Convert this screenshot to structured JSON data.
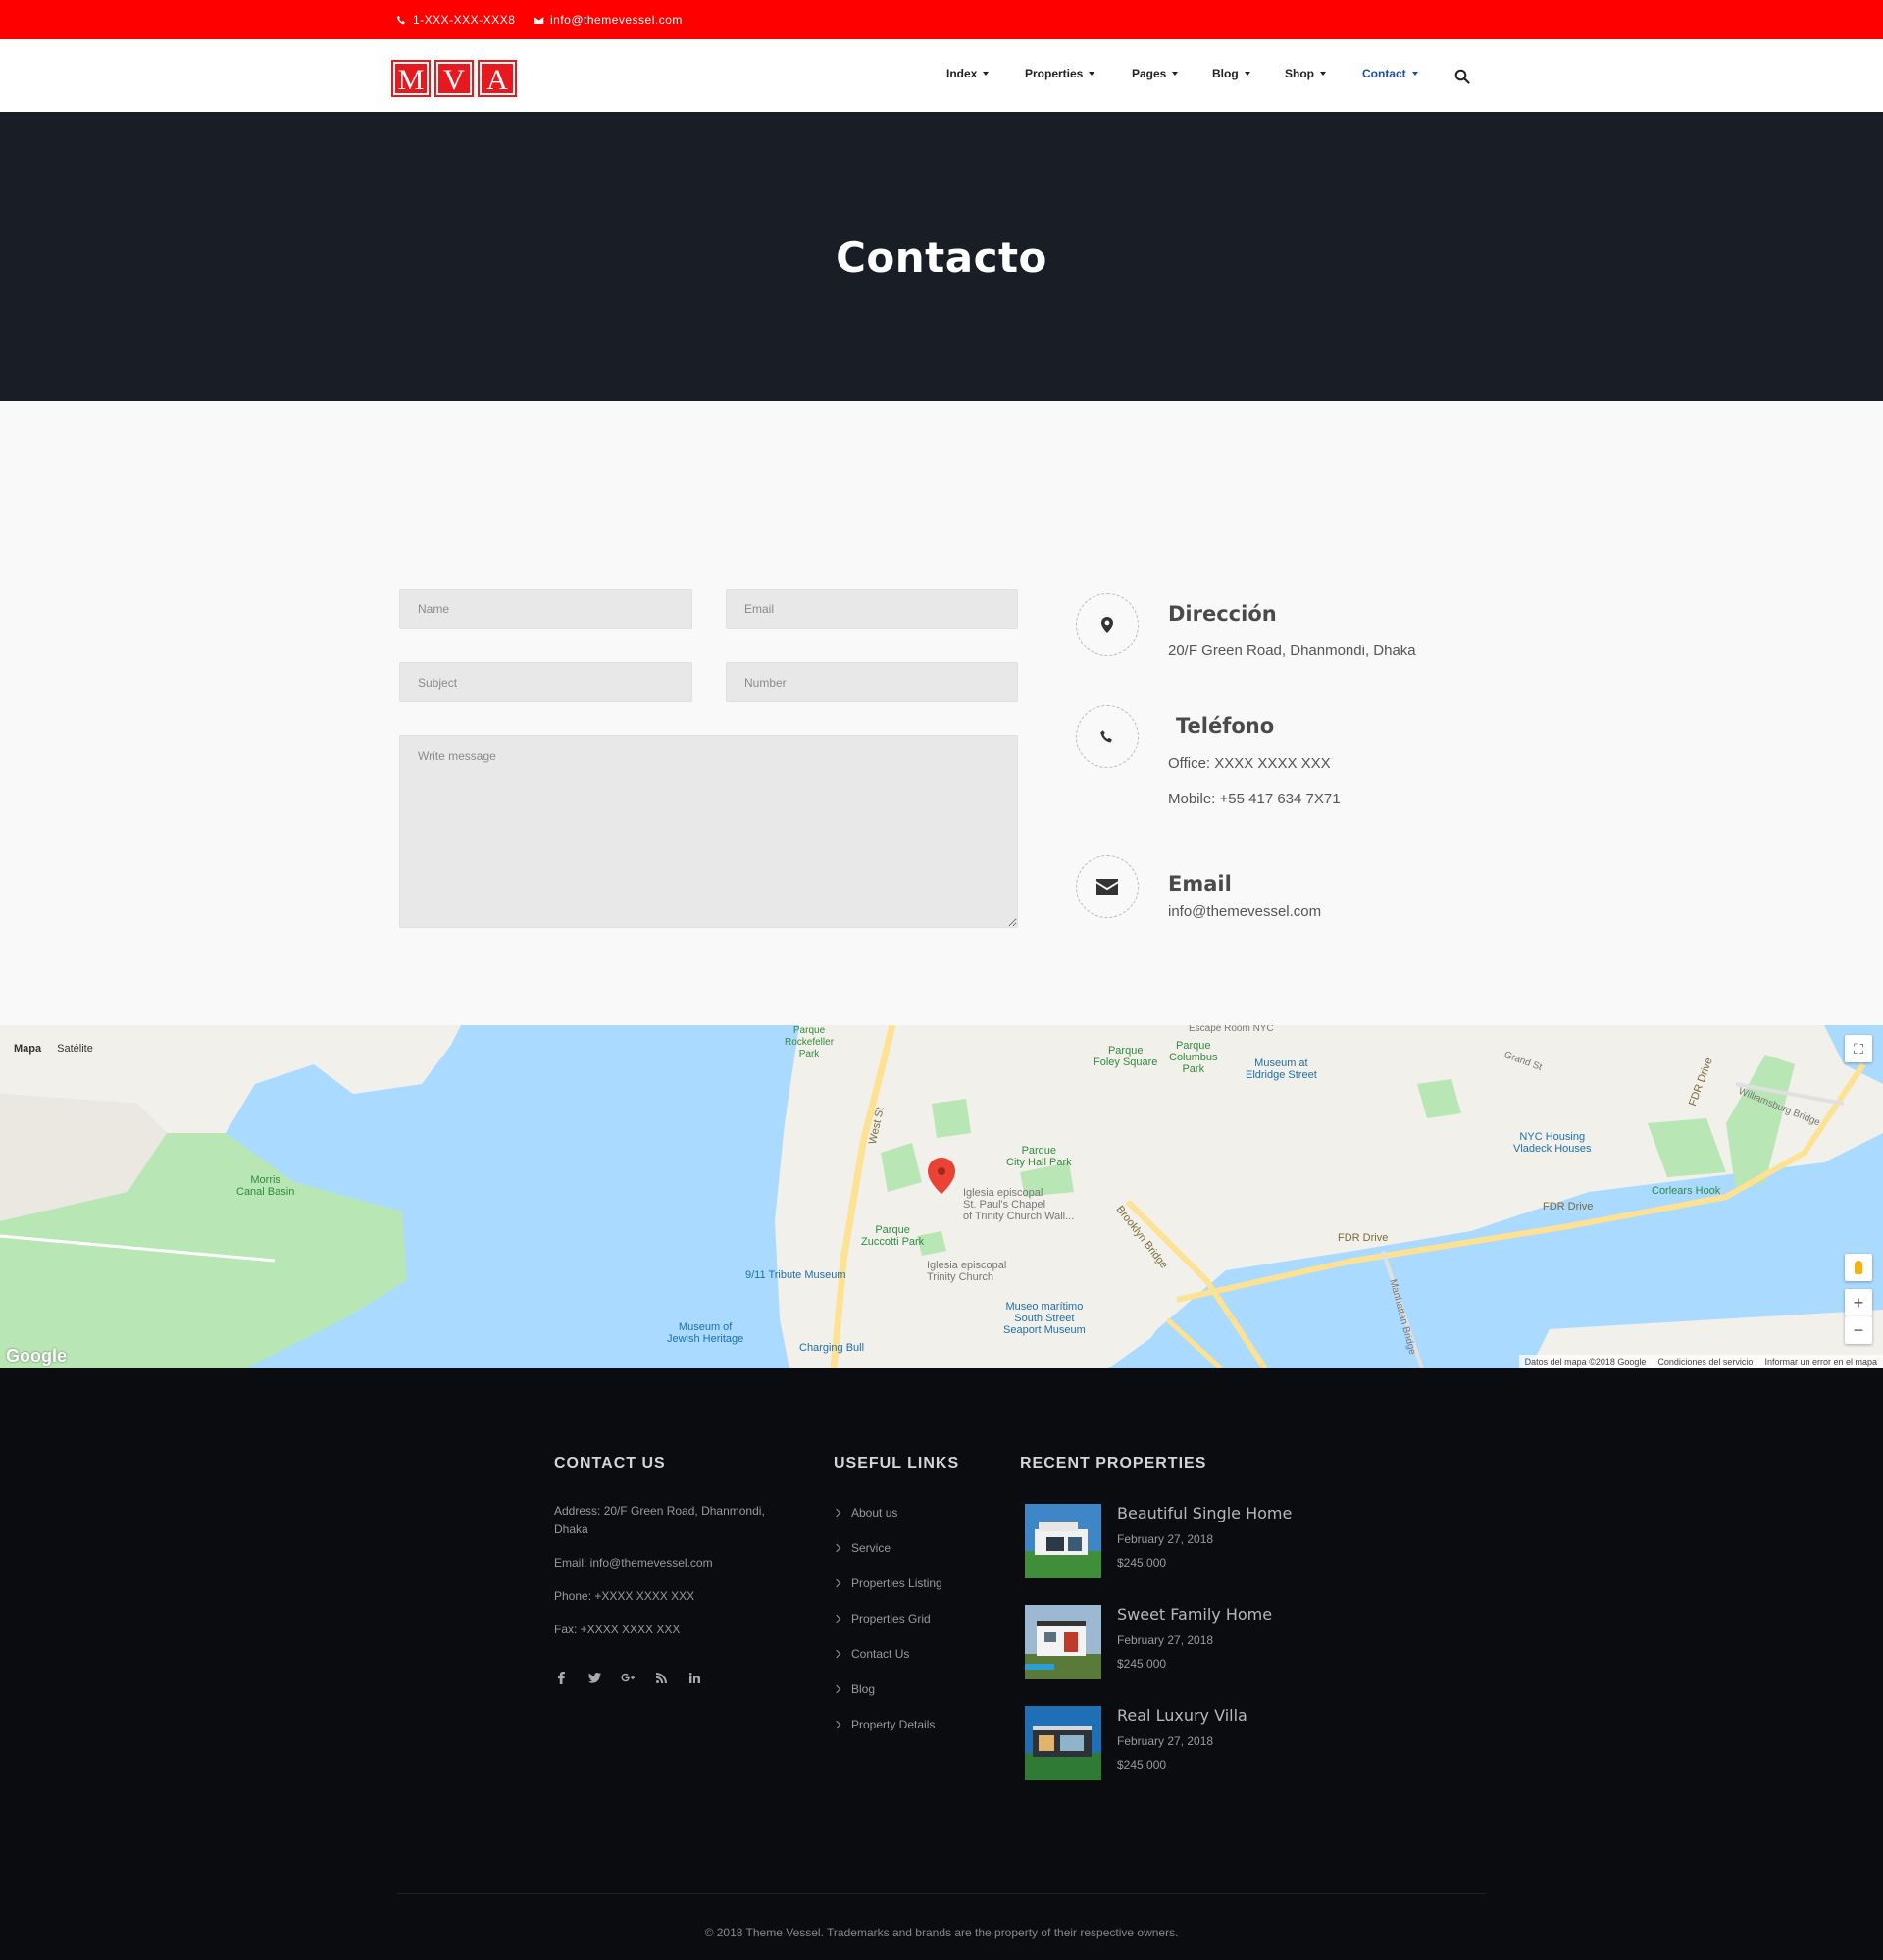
{
  "topbar": {
    "phone": "1-XXX-XXX-XXX8",
    "email": "info@themevessel.com",
    "background": "#ff0000"
  },
  "logo": {
    "letters": [
      "M",
      "V",
      "A"
    ]
  },
  "nav": {
    "items": [
      {
        "label": "Index"
      },
      {
        "label": "Properties"
      },
      {
        "label": "Pages"
      },
      {
        "label": "Blog"
      },
      {
        "label": "Shop"
      },
      {
        "label": "Contact"
      }
    ],
    "active": "Contact"
  },
  "hero": {
    "title": "Contacto"
  },
  "form": {
    "name_placeholder": "Name",
    "email_placeholder": "Email",
    "subject_placeholder": "Subject",
    "number_placeholder": "Number",
    "message_placeholder": "Write message"
  },
  "info": {
    "address": {
      "title": "Dirección",
      "line1": "20/F Green Road, Dhanmondi, Dhaka"
    },
    "phone": {
      "title": "Teléfono",
      "office": "Office: XXXX XXXX XXX",
      "mobile": "Mobile: +55 417 634 7X71"
    },
    "email": {
      "title": "Email",
      "value": "info@themevessel.com"
    }
  },
  "map": {
    "tabs": [
      "Mapa",
      "Satélite"
    ],
    "labels": {
      "morris": "Morris\nCanal Basin",
      "rockefeller": "Parque\nRockefeller\nPark",
      "foley": "Parque\nFoley Square",
      "columbus": "Parque\nColumbus\nPark",
      "eldridge": "Museum at\nEldridge Street",
      "cityhall": "Parque\nCity Hall Park",
      "stpauls": "Iglesia episcopal\nSt. Paul's Chapel\nof Trinity Church Wall...",
      "zuccotti": "Parque\nZuccotti Park",
      "tribute": "9/11 Tribute Museum",
      "trinity": "Iglesia episcopal\nTrinity Church",
      "seaport": "Museo marítimo\nSouth Street\nSeaport Museum",
      "jewish": "Museum of\nJewish Heritage",
      "bull": "Charging Bull",
      "nycha": "NYC Housing\nVladeck Houses",
      "corlears": "Corlears Hook",
      "fdr1": "FDR Drive",
      "fdr2": "FDR Drive",
      "fdr3": "FDR Drive",
      "brooklyn": "Brooklyn Bridge",
      "manhattan": "Manhattan Bridge",
      "williamsburg": "Williamsburg Bridge",
      "weststreet": "West St",
      "grandst": "Grand St",
      "escape": "Escape Room NYC"
    },
    "google": "Google",
    "attribution": [
      "Datos del mapa ©2018 Google",
      "Condiciones del servicio",
      "Informar un error en el mapa"
    ]
  },
  "footer": {
    "contact": {
      "heading": "CONTACT US",
      "address": "Address: 20/F Green Road, Dhanmondi, Dhaka",
      "email": "Email: info@themevessel.com",
      "phone": "Phone: +XXXX XXXX XXX",
      "fax": "Fax: +XXXX XXXX XXX"
    },
    "links": {
      "heading": "USEFUL LINKS",
      "items": [
        "About us",
        "Service",
        "Properties Listing",
        "Properties Grid",
        "Contact Us",
        "Blog",
        "Property Details"
      ]
    },
    "recent": {
      "heading": "RECENT PROPERTIES",
      "items": [
        {
          "title": "Beautiful Single Home",
          "date": "February 27, 2018",
          "price": "$245,000"
        },
        {
          "title": "Sweet Family Home",
          "date": "February 27, 2018",
          "price": "$245,000"
        },
        {
          "title": "Real Luxury Villa",
          "date": "February 27, 2018",
          "price": "$245,000"
        }
      ]
    },
    "social": [
      "facebook-icon",
      "twitter-icon",
      "google-plus-icon",
      "rss-icon",
      "linkedin-icon"
    ],
    "copyright": "© 2018 Theme Vessel. Trademarks and brands are the property of their respective owners."
  }
}
